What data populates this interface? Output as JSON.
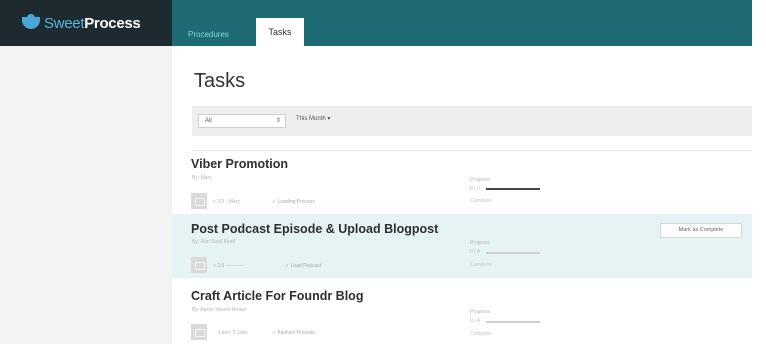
{
  "app": {
    "logo_sweet": "Sweet",
    "logo_process": "Process"
  },
  "nav": {
    "tabs": [
      {
        "label": "Procedures",
        "active": false
      },
      {
        "label": "Tasks",
        "active": true
      }
    ]
  },
  "page": {
    "title": "Tasks"
  },
  "filters": {
    "assignee": "All",
    "period": "This Month ▾"
  },
  "tasks": [
    {
      "title": "Viber Promotion",
      "subtitle": "By: Mary",
      "meta": "+ 2/3 · Mary",
      "meta_link": "✓ Loading Process",
      "progress_label": "Progress",
      "progress_pct": "0 / 0",
      "progress_value": 1.0,
      "progress_note": "Complete",
      "highlighted": false
    },
    {
      "title": "Post Podcast Episode & Upload Blogpost",
      "subtitle": "By: Ron Sunil Kindl",
      "meta": "+ 2/3 ─────",
      "meta_link": "✓ Load Podcast",
      "progress_label": "Progress",
      "progress_pct": "0 / 4",
      "progress_value": 0.0,
      "progress_note": "Complete",
      "highlighted": true,
      "action_label": "Mark as Complete"
    },
    {
      "title": "Craft Article For Foundr Blog",
      "subtitle": "By: Aaron Steven Brown",
      "meta": "Lenn: 5 Jobs",
      "meta_link": "✓ Fashion Process",
      "progress_label": "Progress",
      "progress_pct": "0 / 4",
      "progress_value": 0.0,
      "progress_note": "Complete",
      "highlighted": false
    }
  ],
  "colors": {
    "topbar": "#1f6b75",
    "logo_bg": "#1d2a2f",
    "highlight_row": "#e6f3f5",
    "accent": "#5ab3e0"
  }
}
